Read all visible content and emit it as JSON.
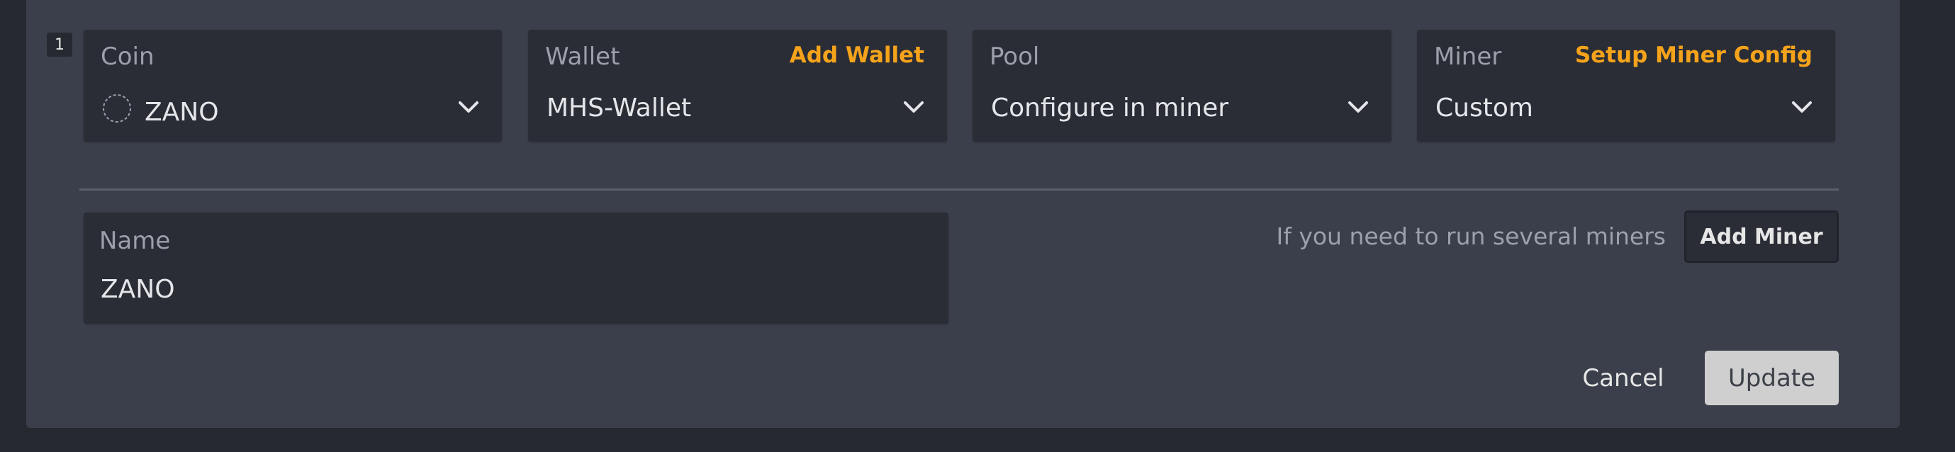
{
  "row": {
    "index": "1"
  },
  "coin": {
    "label": "Coin",
    "value": "ZANO",
    "icon": "coin-placeholder-icon"
  },
  "wallet": {
    "label": "Wallet",
    "link": "Add Wallet",
    "value": "MHS-Wallet"
  },
  "pool": {
    "label": "Pool",
    "value": "Configure in miner"
  },
  "miner": {
    "label": "Miner",
    "link": "Setup Miner Config",
    "value": "Custom"
  },
  "name": {
    "label": "Name",
    "value": "ZANO"
  },
  "hint": "If you need to run several miners",
  "buttons": {
    "add_miner": "Add Miner",
    "cancel": "Cancel",
    "update": "Update"
  },
  "colors": {
    "accent": "#f5a31b",
    "panel": "#3a3f4b",
    "field": "#2a2d35",
    "background": "#262930"
  }
}
